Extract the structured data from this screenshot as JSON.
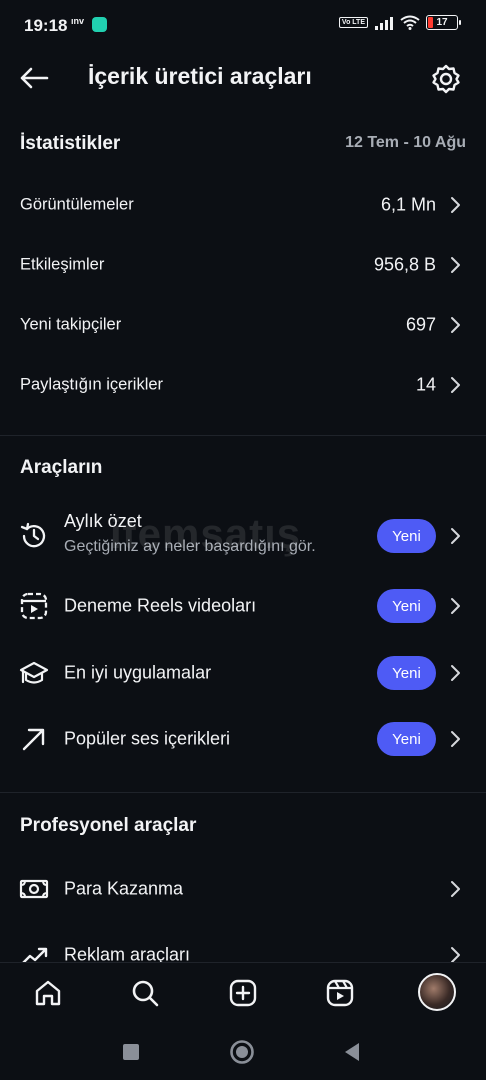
{
  "status_bar": {
    "time": "19:18",
    "carrier": "ınv",
    "volte": "Vo LTE",
    "battery": "17"
  },
  "header": {
    "title": "İçerik üretici araçları"
  },
  "statistics": {
    "title": "İstatistikler",
    "date_range": "12 Tem - 10 Ağu",
    "rows": [
      {
        "label": "Görüntülemeler",
        "value": "6,1 Mn"
      },
      {
        "label": "Etkileşimler",
        "value": "956,8 B"
      },
      {
        "label": "Yeni takipçiler",
        "value": "697"
      },
      {
        "label": "Paylaştığın içerikler",
        "value": "14"
      }
    ]
  },
  "tools": {
    "title": "Araçların",
    "rows": [
      {
        "label": "Aylık özet",
        "sub": "Geçtiğimiz ay neler başardığını gör.",
        "badge": "Yeni",
        "icon": "history-icon"
      },
      {
        "label": "Deneme Reels videoları",
        "badge": "Yeni",
        "icon": "reels-trial-icon"
      },
      {
        "label": "En iyi uygulamalar",
        "badge": "Yeni",
        "icon": "graduation-cap-icon"
      },
      {
        "label": "Popüler ses içerikleri",
        "badge": "Yeni",
        "icon": "trending-arrow-icon"
      }
    ]
  },
  "professional": {
    "title": "Profesyonel araçlar",
    "rows": [
      {
        "label": "Para Kazanma",
        "icon": "money-icon"
      },
      {
        "label": "Reklam araçları",
        "icon": "chart-up-icon"
      }
    ]
  },
  "watermark": "itemsatış",
  "bottom_nav": [
    "home-icon",
    "search-icon",
    "create-icon",
    "reels-icon",
    "profile-avatar"
  ],
  "colors": {
    "background": "#0c0f14",
    "accent": "#4e5bf5",
    "text": "#f2f3f5",
    "muted": "#a8adb5",
    "battery_low": "#ff3b30"
  }
}
